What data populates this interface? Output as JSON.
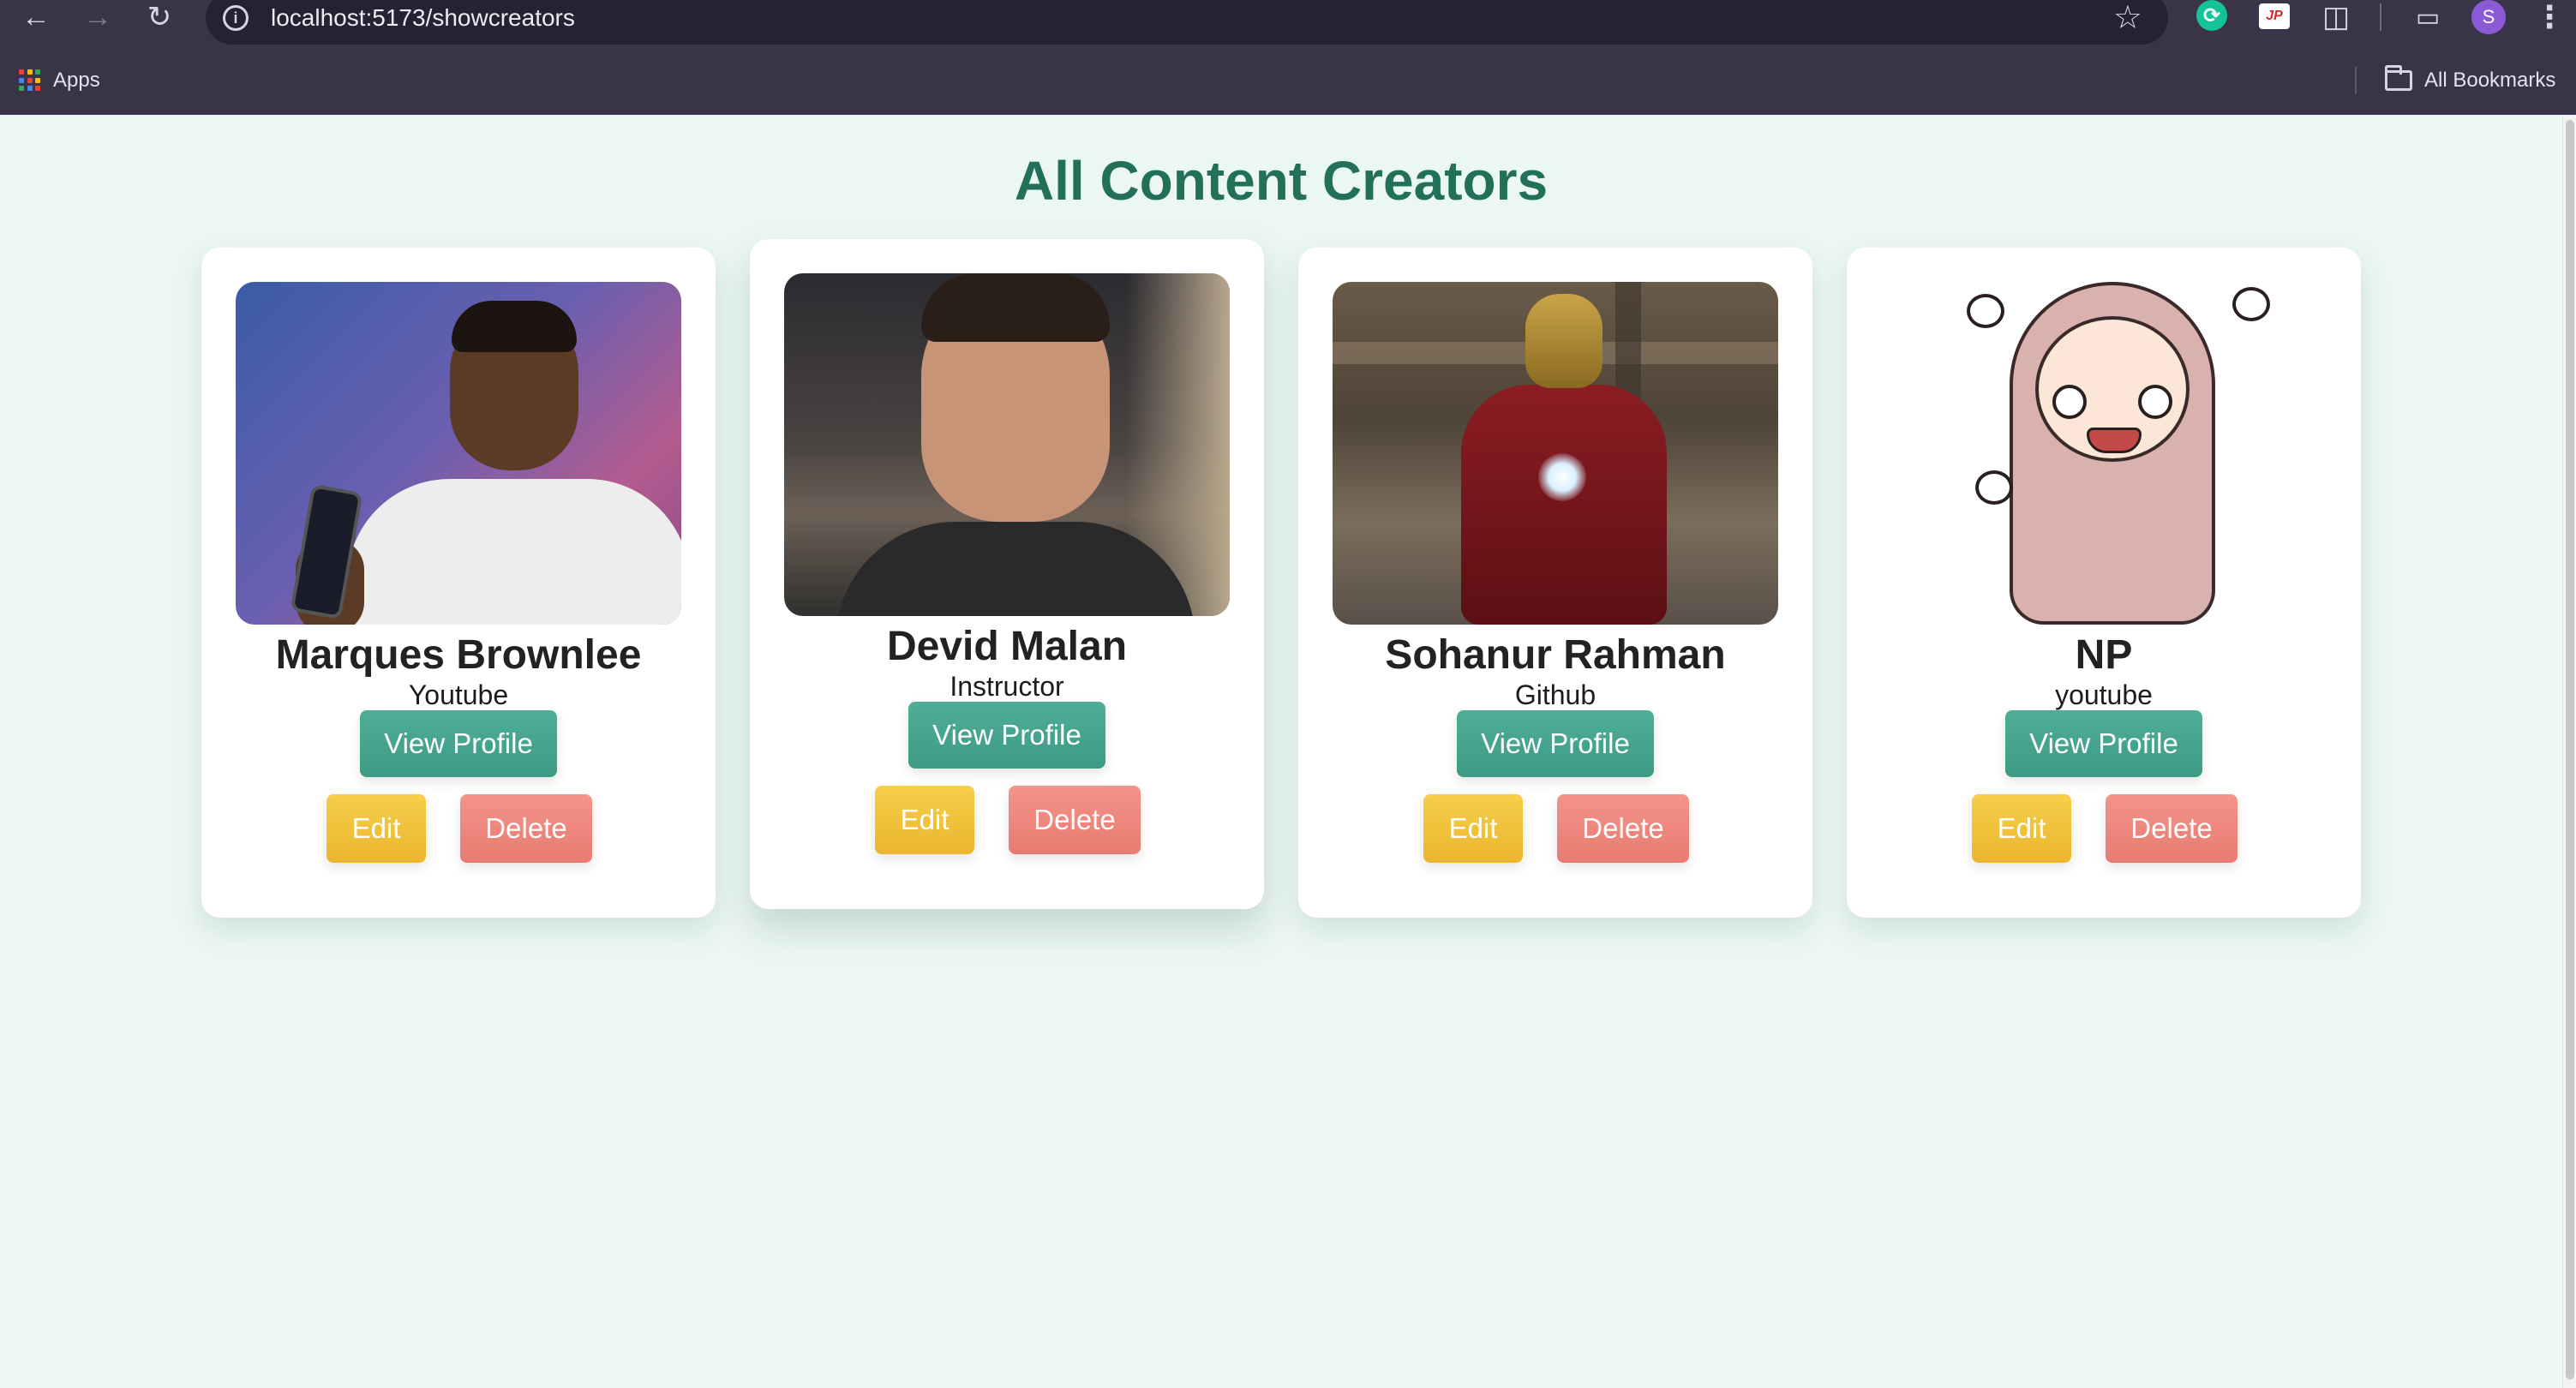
{
  "browser": {
    "url": "localhost:5173/showcreators",
    "profile_initial": "S",
    "bookmarks_apps_label": "Apps",
    "bookmarks_all_label": "All Bookmarks"
  },
  "page": {
    "title": "All Content Creators"
  },
  "creators": [
    {
      "name": "Marques Brownlee",
      "role": "Youtube",
      "view_label": "View Profile",
      "edit_label": "Edit",
      "delete_label": "Delete"
    },
    {
      "name": "Devid Malan",
      "role": "Instructor",
      "view_label": "View Profile",
      "edit_label": "Edit",
      "delete_label": "Delete"
    },
    {
      "name": "Sohanur Rahman",
      "role": "Github",
      "view_label": "View Profile",
      "edit_label": "Edit",
      "delete_label": "Delete"
    },
    {
      "name": "NP",
      "role": "youtube",
      "view_label": "View Profile",
      "edit_label": "Edit",
      "delete_label": "Delete"
    }
  ],
  "colors": {
    "title": "#23705a",
    "view_button": "#47a690",
    "edit_button": "#f0c13a",
    "delete_button": "#ec857b",
    "page_background": "#ebf7f3"
  }
}
